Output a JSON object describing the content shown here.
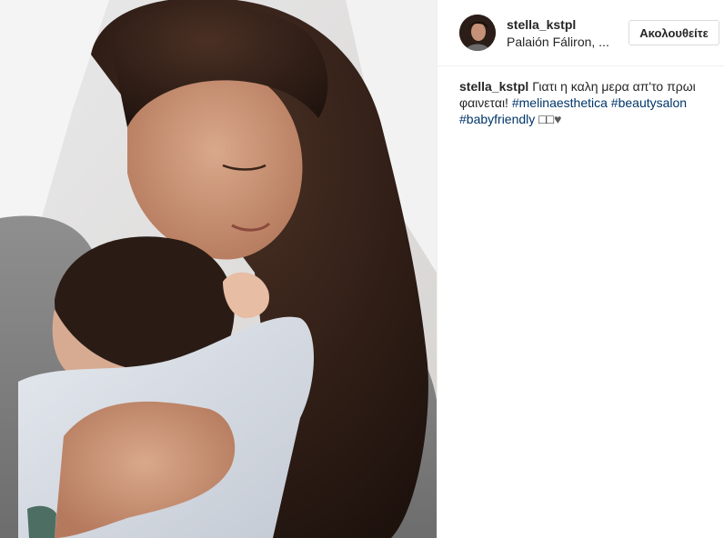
{
  "post": {
    "username": "stella_kstpl",
    "location": "Palaión Fáliron, ...",
    "follow_label": "Ακολουθείτε",
    "caption": {
      "username": "stella_kstpl",
      "text_line1": "Γιατι η καλη μερα απ'το πρωι",
      "text_line2": "φαινεται!",
      "hashtag1": "#melinaesthetica",
      "hashtag2": "#beautysalon",
      "hashtag3": "#babyfriendly",
      "emoji_boxes": "□□",
      "emoji_heart": "♥"
    },
    "photo": {
      "subject": "mother holding newborn baby",
      "icon": "photo"
    }
  }
}
